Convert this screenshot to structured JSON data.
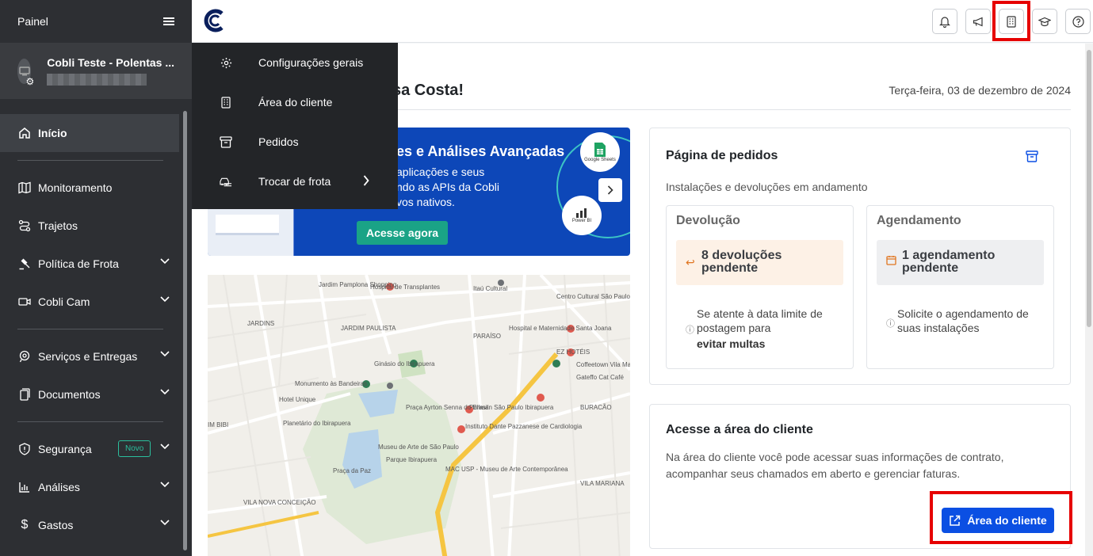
{
  "sidebar": {
    "header": "Painel",
    "account_name": "Cobli Teste - Polentas ...",
    "items": [
      {
        "label": "Início"
      },
      {
        "label": "Monitoramento"
      },
      {
        "label": "Trajetos"
      },
      {
        "label": "Política de Frota"
      },
      {
        "label": "Cobli Cam"
      },
      {
        "label": "Serviços e Entregas"
      },
      {
        "label": "Documentos"
      },
      {
        "label": "Segurança",
        "badge": "Novo"
      },
      {
        "label": "Análises"
      },
      {
        "label": "Gastos"
      }
    ]
  },
  "menu": {
    "items": [
      {
        "label": "Configurações gerais"
      },
      {
        "label": "Área do cliente"
      },
      {
        "label": "Pedidos"
      },
      {
        "label": "Trocar de frota"
      }
    ]
  },
  "main": {
    "greeting": "sa Costa!",
    "date": "Terça-feira, 03 de dezembro de 2024",
    "banner": {
      "title": "es e Análises Avançadas",
      "line1": "aplicações e seus",
      "line2": "ndo as APIs da Cobli",
      "line3": "vos nativos.",
      "button": "Acesse agora",
      "badge1": "Google Sheets",
      "badge2": "Power BI"
    },
    "orders_card": {
      "title": "Página de pedidos",
      "subtitle": "Instalações e devoluções em andamento",
      "devolucao": {
        "label": "Devolução",
        "line1": "8 devoluções",
        "line2": "pendente",
        "note1": "Se atente à data limite de",
        "note2": "postagem para",
        "note3": "evitar multas"
      },
      "agendamento": {
        "label": "Agendamento",
        "line1": "1 agendamento",
        "line2": "pendente",
        "note1": "Solicite o agendamento de",
        "note2": "suas instalações"
      }
    },
    "client_card": {
      "title": "Acesse a área do cliente",
      "line1": "Na área do cliente você pode acessar suas informações de contrato,",
      "line2": "acompanhar seus chamados em aberto e gerenciar faturas.",
      "button": "Área do cliente"
    }
  },
  "map_labels": [
    "JARDINS",
    "JARDIM PAULISTA",
    "PARAÍSO",
    "IM BIBI",
    "VILA NOVA CONCEIÇÃO",
    "VILA MARIANA",
    "BURACÃO",
    "Monumento às Bandeiras",
    "Ginásio do Ibirapuera",
    "Planetário do Ibirapuera",
    "Museu de Arte de São Paulo",
    "Praça da Paz",
    "Parque Ibirapuera",
    "Hospital e Maternidade Santa Joana",
    "Centro Cultural São Paulo",
    "Itaú Cultural",
    "Hospital de Transplantes",
    "Jardim Pamplona Shopping",
    "Pullman São Paulo Ibirapuera",
    "Instituto Dante Pazzanese de Cardiologia",
    "EZ HOTÉIS",
    "Coffeetown Vila Mariana",
    "Hotel Unique",
    "Gateffo Cat Café",
    "Praça Ayrton Senna do Brasil",
    "MAC USP - Museu de Arte Contemporânea"
  ],
  "colors": {
    "sidebar_bg": "#2d2f33",
    "menu_bg": "#232528",
    "primary": "#0b4fe3",
    "teal": "#1aa386",
    "highlight": "#e60000"
  }
}
